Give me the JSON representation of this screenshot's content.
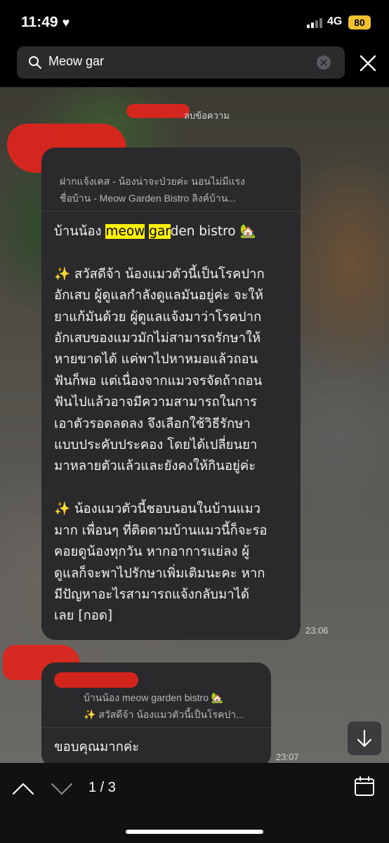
{
  "status_bar": {
    "time": "11:49",
    "network": "4G",
    "battery": "80"
  },
  "search": {
    "value": "Meow gar"
  },
  "chat": {
    "sender_note": "ลบข้อความ",
    "message1": {
      "reply_line1": "ฝากแจ้งเคส - น้องน่าจะป่วยค่ะ นอนไม่มีแรง",
      "reply_line2": "ชื่อบ้าน - Meow Garden Bistro ลิงค์บ้าน...",
      "title_pre": "บ้านน้อง ",
      "title_hl1": "meow",
      "title_sp": " ",
      "title_hl2": "gar",
      "title_post": "den bistro 🏡",
      "para1": [
        "✨  สวัสดีจ้า น้องแมวตัวนี้เป็นโรคปาก",
        "อักเสบ ผู้ดูแลกำลังดูแลมันอยู่ค่ะ จะให้",
        "ยาแก้มันด้วย ผู้ดูแลแจ้งมาว่าโรคปาก",
        "อักเสบของแมวมักไม่สามารถรักษาให้",
        "หายขาดได้ แค่พาไปหาหมอแล้วถอน",
        "ฟันก็พอ แต่เนื่องจากแมวจรจัดถ้าถอน",
        "ฟันไปแล้วอาจมีความสามารถในการ",
        "เอาตัวรอดลดลง จึงเลือกใช้วิธีรักษา",
        "แบบประคับประคอง โดยได้เปลี่ยนยา",
        "มาหลายตัวแล้วและยังคงให้กินอยู่ค่ะ"
      ],
      "para2": [
        "✨  น้องแมวตัวนี้ชอบนอนในบ้านแมว",
        "มาก เพื่อนๆ ที่ติดตามบ้านแมวนี้ก็จะรอ",
        "คอยดูน้องทุกวัน หากอาการแย่ลง ผู้",
        "ดูแลก็จะพาไปรักษาเพิ่มเติมนะคะ หาก",
        "มีปัญหาอะไรสามารถแจ้งกลับมาได้",
        "เลย [กอด]"
      ],
      "time": "23:06"
    },
    "message2": {
      "reply_line1": "บ้านน้อง meow garden bistro 🏡",
      "reply_line2": "✨  สวัสดีจ้า น้องแมวตัวนี้เป็นโรคปา...",
      "text": "ขอบคุณมากค่ะ",
      "time": "23:07"
    }
  },
  "bottom_bar": {
    "counter": "1 / 3"
  },
  "colors": {
    "highlight": "#fff200",
    "bubble": "#2a2a2c",
    "battery": "#f2c12e"
  }
}
